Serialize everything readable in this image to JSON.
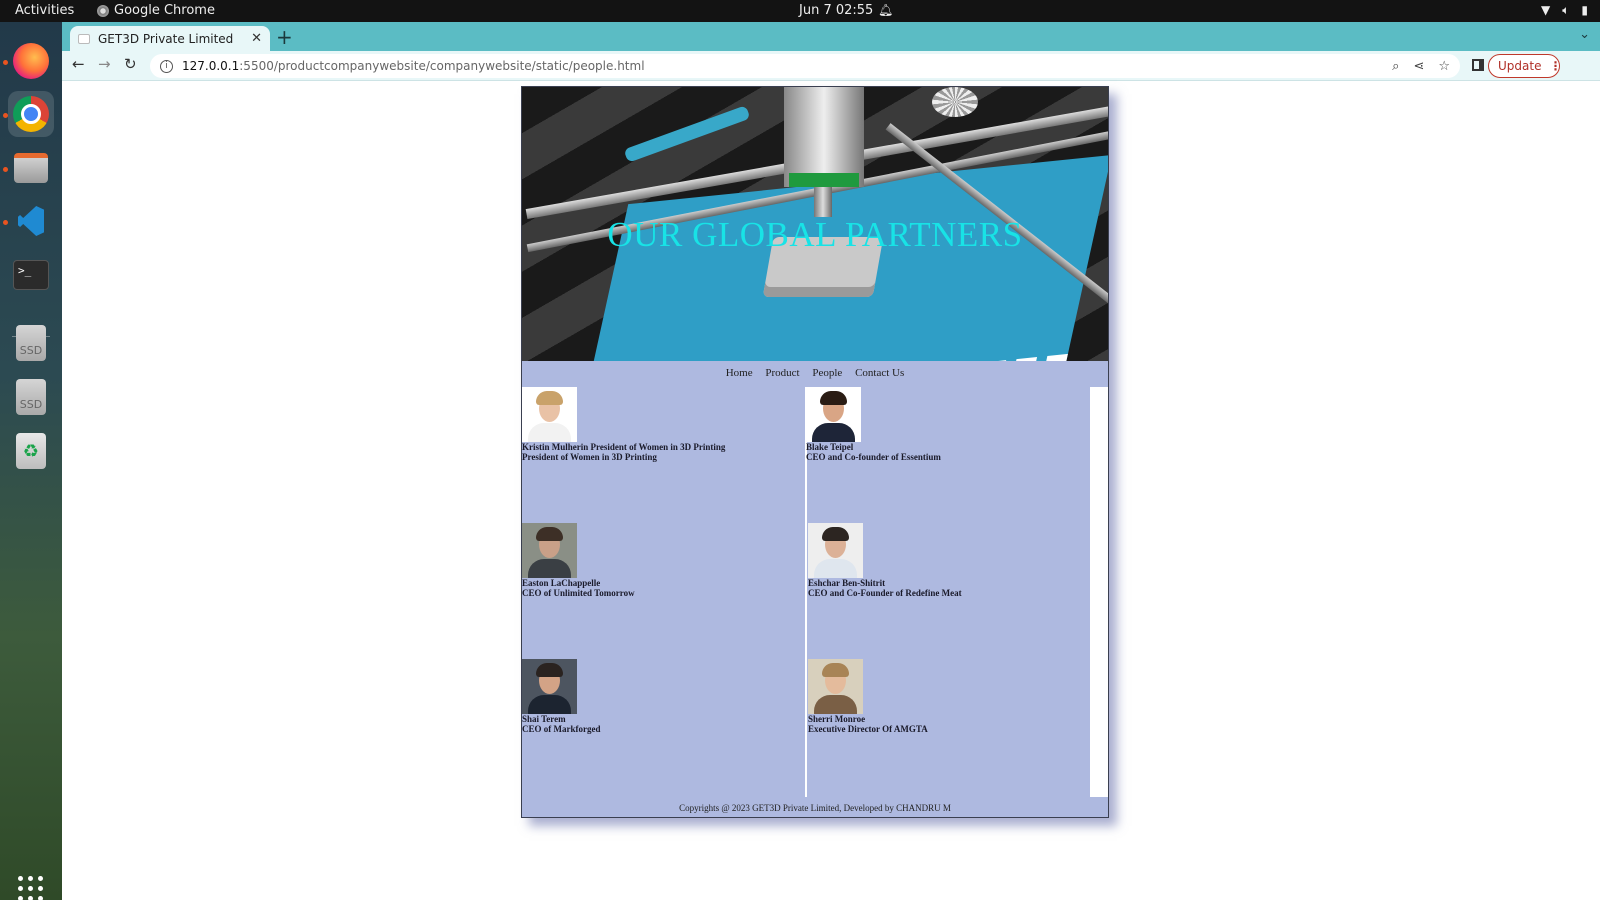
{
  "system_bar": {
    "activities": "Activities",
    "app_name": "Google Chrome",
    "clock": "Jun 7  02:55"
  },
  "dock": {
    "apps": [
      "firefox-icon",
      "chrome-icon",
      "files-icon",
      "vscode-icon",
      "terminal-icon",
      "ssd-drive-icon",
      "ssd-drive-icon",
      "trash-icon",
      "app-grid-icon"
    ],
    "ssd_label": "SSD"
  },
  "browser": {
    "tab_title": "GET3D Private Limited",
    "url_host": "127.0.0.1",
    "url_path": ":5500/productcompanywebsite/companywebsite/static/people.html",
    "update_label": "Update"
  },
  "page": {
    "hero_title": "OUR GLOBAL PARTNERS",
    "nav": [
      "Home",
      "Product",
      "People",
      "Contact Us"
    ],
    "people": [
      {
        "name": "Kristin Mulherin President of Women in 3D Printing",
        "role": "President of Women in 3D Printing",
        "skin": "#e9c2a6",
        "hair": "#c9a26a",
        "clothes": "#f2f2f2",
        "bg": "#ffffff"
      },
      {
        "name": "Blake Teipel",
        "role": "CEO and Co-founder of Essentium",
        "skin": "#d9a585",
        "hair": "#2a1c14",
        "clothes": "#1e2538",
        "bg": "#ffffff"
      },
      {
        "name": "Easton LaChappelle",
        "role": "CEO of Unlimited Tomorrow",
        "skin": "#c9a088",
        "hair": "#3d2f26",
        "clothes": "#3a3f44",
        "bg": "#8a8f86"
      },
      {
        "name": "Eshchar Ben-Shitrit",
        "role": "CEO and Co-Founder of Redefine Meat",
        "skin": "#dcb197",
        "hair": "#2c2521",
        "clothes": "#dfe6ee",
        "bg": "#eeeeee"
      },
      {
        "name": "Shai Terem",
        "role": "CEO of Markforged",
        "skin": "#d3a386",
        "hair": "#2a2320",
        "clothes": "#1c2430",
        "bg": "#4d5560"
      },
      {
        "name": "Sherri Monroe",
        "role": "Executive Director Of AMGTA",
        "skin": "#e4bb9c",
        "hair": "#a88456",
        "clothes": "#7a5f45",
        "bg": "#d8d0bd"
      }
    ],
    "footer": "Copyrights @ 2023 GET3D Private Limited, Developed by CHANDRU M"
  }
}
